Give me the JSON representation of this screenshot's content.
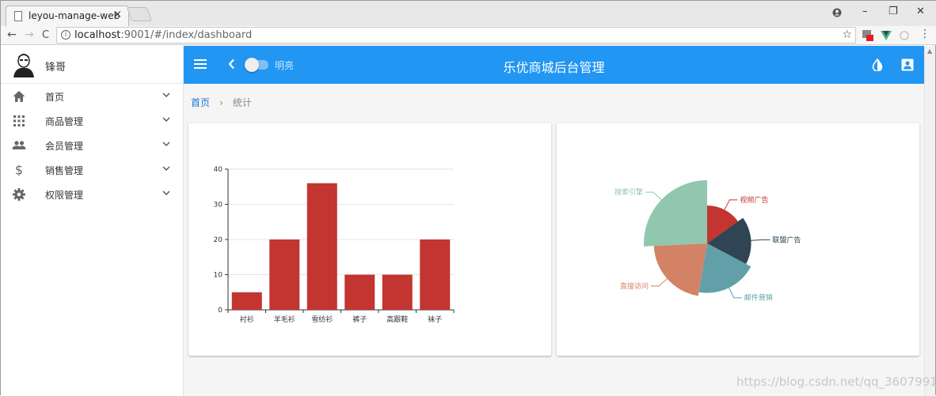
{
  "browser": {
    "tab_title": "leyou-manage-web",
    "tab_close": "×",
    "url_host": "localhost",
    "url_rest": ":9001/#/index/dashboard",
    "back": "←",
    "forward": "→",
    "reload": "C",
    "star": "☆",
    "win_min": "–",
    "win_max": "❐",
    "win_close": "✕",
    "menu_dots": "⋮"
  },
  "user": {
    "name": "锋哥"
  },
  "sidebar": {
    "items": [
      {
        "label": "首页",
        "icon": "home-icon"
      },
      {
        "label": "商品管理",
        "icon": "apps-icon"
      },
      {
        "label": "会员管理",
        "icon": "people-icon"
      },
      {
        "label": "销售管理",
        "icon": "dollar-icon"
      },
      {
        "label": "权限管理",
        "icon": "gear-icon"
      }
    ]
  },
  "toolbar": {
    "switch_label": "明亮",
    "title": "乐优商城后台管理"
  },
  "breadcrumb": {
    "home": "首页",
    "separator": "›",
    "current": "统计"
  },
  "colors": {
    "primary": "#2196f3",
    "bar": "#c23531",
    "pie": [
      "#c23531",
      "#2f4554",
      "#61a0a8",
      "#d48265",
      "#91c7ae"
    ]
  },
  "chart_data": [
    {
      "type": "bar",
      "categories": [
        "衬衫",
        "羊毛衫",
        "雪纺衫",
        "裤子",
        "高跟鞋",
        "袜子"
      ],
      "values": [
        5,
        20,
        36,
        10,
        10,
        20
      ],
      "ylim": [
        0,
        40
      ],
      "yticks": [
        0,
        10,
        20,
        30,
        40
      ],
      "grid": true
    },
    {
      "type": "pie",
      "rose": "radius",
      "slices": [
        {
          "name": "视频广告",
          "value": 235
        },
        {
          "name": "联盟广告",
          "value": 274
        },
        {
          "name": "邮件营销",
          "value": 310
        },
        {
          "name": "直接访问",
          "value": 335
        },
        {
          "name": "搜索引擎",
          "value": 400
        }
      ]
    }
  ],
  "watermark": "https://blog.csdn.net/qq_36079912"
}
